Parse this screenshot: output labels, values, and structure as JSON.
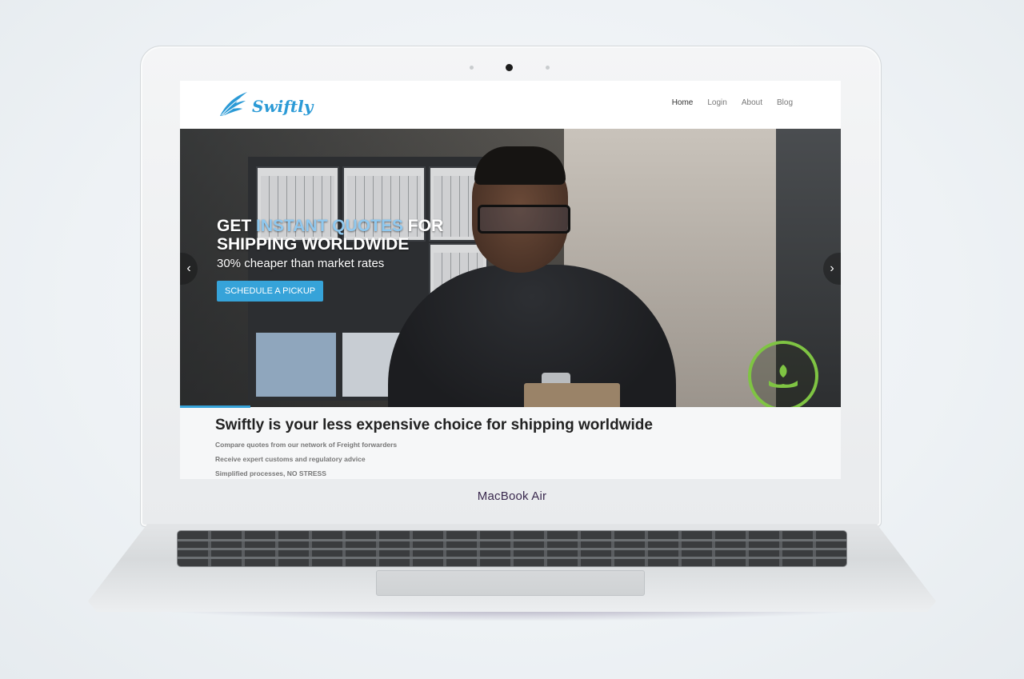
{
  "device": {
    "model_label": "MacBook Air"
  },
  "site": {
    "brand": "Swiftly",
    "nav": [
      {
        "label": "Home",
        "active": true
      },
      {
        "label": "Login",
        "active": false
      },
      {
        "label": "About",
        "active": false
      },
      {
        "label": "Blog",
        "active": false
      }
    ]
  },
  "hero": {
    "title_part1": "GET ",
    "title_highlight": "INSTANT QUOTES",
    "title_part2": " FOR",
    "title_line2": "SHIPPING WORLDWIDE",
    "subtitle": "30% cheaper than market rates",
    "cta_label": "SCHEDULE A PICKUP",
    "prev_glyph": "‹",
    "next_glyph": "›"
  },
  "content": {
    "heading": "Swiftly is your less expensive choice for shipping worldwide",
    "features": [
      "Compare quotes from our network of Freight forwarders",
      "Receive expert customs and regulatory advice",
      "Simplified processes, NO STRESS"
    ]
  },
  "colors": {
    "accent": "#36a3d9",
    "brand": "#2b9ad6",
    "badge": "#7fc443"
  },
  "icons": {
    "logo": "wing-icon",
    "badge": "hands-leaf-icon"
  }
}
